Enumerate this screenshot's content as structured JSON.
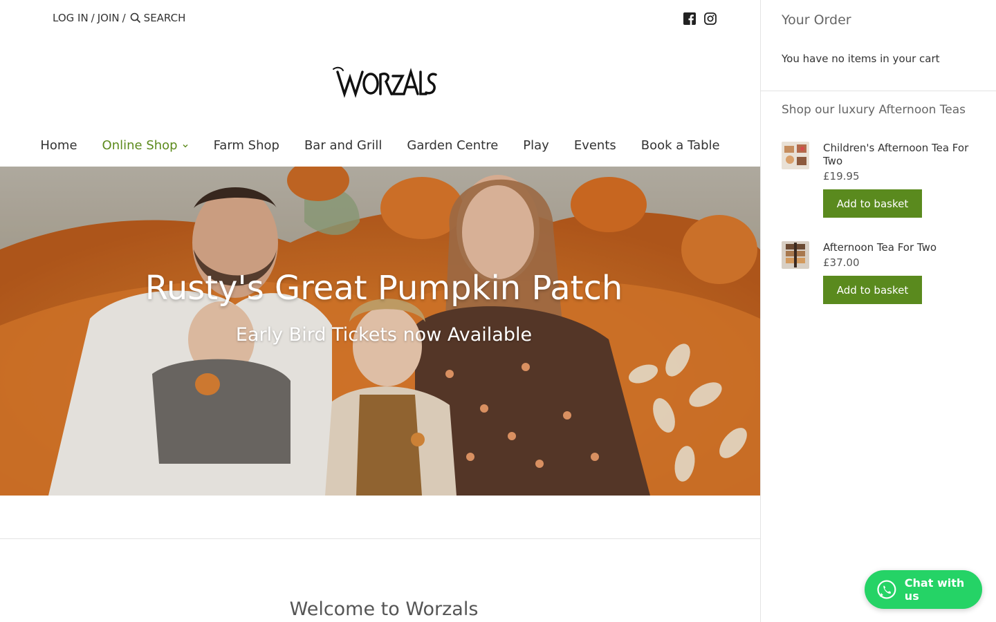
{
  "header": {
    "login_label": "LOG IN",
    "sep1": "/",
    "join_label": "JOIN",
    "sep2": "/",
    "search_label": "SEARCH"
  },
  "logo": {
    "text": "WORZALS"
  },
  "nav": {
    "items": [
      {
        "label": "Home"
      },
      {
        "label": "Online Shop",
        "active": true
      },
      {
        "label": "Farm Shop"
      },
      {
        "label": "Bar and Grill"
      },
      {
        "label": "Garden Centre"
      },
      {
        "label": "Play"
      },
      {
        "label": "Events"
      },
      {
        "label": "Book a Table"
      }
    ]
  },
  "hero": {
    "title": "Rusty's Great Pumpkin Patch",
    "subtitle": "Early Bird Tickets now Available"
  },
  "welcome": {
    "heading": "Welcome to Worzals"
  },
  "cart": {
    "title": "Your Order",
    "empty_message": "You have no items in your cart",
    "shop_heading": "Shop our luxury Afternoon Teas",
    "products": [
      {
        "name": "Children's Afternoon Tea For Two",
        "price": "£19.95",
        "button": "Add to basket"
      },
      {
        "name": "Afternoon Tea For Two",
        "price": "£37.00",
        "button": "Add to basket"
      }
    ]
  },
  "chat": {
    "label": "Chat with us"
  },
  "colors": {
    "accent": "#5a8a1e",
    "nav_active": "#5c8a1c",
    "whatsapp": "#25d366"
  }
}
